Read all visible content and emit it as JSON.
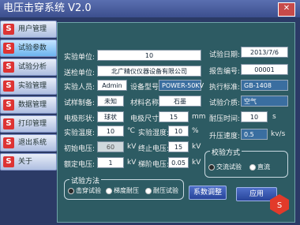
{
  "app": {
    "title": "电压击穿系统 V2.0"
  },
  "sidebar": {
    "items": [
      {
        "label": "用户管理"
      },
      {
        "label": "试验参数"
      },
      {
        "label": "试验分析"
      },
      {
        "label": "实验管理"
      },
      {
        "label": "数据管理"
      },
      {
        "label": "打印管理"
      },
      {
        "label": "退出系统"
      },
      {
        "label": "关于"
      }
    ]
  },
  "form": {
    "lab_unit_label": "实验单位:",
    "lab_unit_value": "10",
    "test_date_label": "试验日期:",
    "test_date_value": "2013/7/6",
    "send_unit_label": "送检单位:",
    "send_unit_value": "北广精仪仪器设备有限公司",
    "report_no_label": "报告编号:",
    "report_no_value": "00001",
    "tester_label": "实验人员:",
    "tester_value": "Admin",
    "device_model_label": "设备型号:",
    "device_model_value": "POWER-50KV",
    "standard_label": "执行标准:",
    "standard_value": "GB-1408",
    "sample_prep_label": "试样制备:",
    "sample_prep_value": "未知",
    "material_label": "材料名称:",
    "material_value": "石墨",
    "medium_label": "试验介质:",
    "medium_value": "空气",
    "electrode_shape_label": "电极形状:",
    "electrode_shape_value": "球状",
    "electrode_size_label": "电极尺寸:",
    "electrode_size_value": "15",
    "electrode_size_unit": "mm",
    "withstand_time_label": "耐压时间:",
    "withstand_time_value": "10",
    "withstand_time_unit": "s",
    "temp_label": "实验温度:",
    "temp_value": "10",
    "temp_unit": "℃",
    "humidity_label": "实验湿度:",
    "humidity_value": "10",
    "humidity_unit": "%",
    "rise_speed_label": "升压速度:",
    "rise_speed_value": "0.5",
    "rise_speed_unit": "kv/s",
    "init_voltage_label": "初始电压:",
    "init_voltage_value": "60",
    "init_voltage_unit": "kV",
    "stop_voltage_label": "终止电压:",
    "stop_voltage_value": "15",
    "stop_voltage_unit": "kV",
    "rated_voltage_label": "额定电压:",
    "rated_voltage_value": "1",
    "rated_voltage_unit": "kV",
    "step_voltage_label": "梯阶电压:",
    "step_voltage_value": "0.05",
    "step_voltage_unit": "kV"
  },
  "method_group": {
    "title": "试验方法",
    "options": [
      "击穿试验",
      "梯度耐压",
      "耐压试验"
    ],
    "selected": 0
  },
  "mode_group": {
    "title": "校验方式",
    "options": [
      "交流试验",
      "直流"
    ],
    "selected": 0
  },
  "buttons": {
    "calibrate": "系数调整",
    "apply": "应用"
  }
}
